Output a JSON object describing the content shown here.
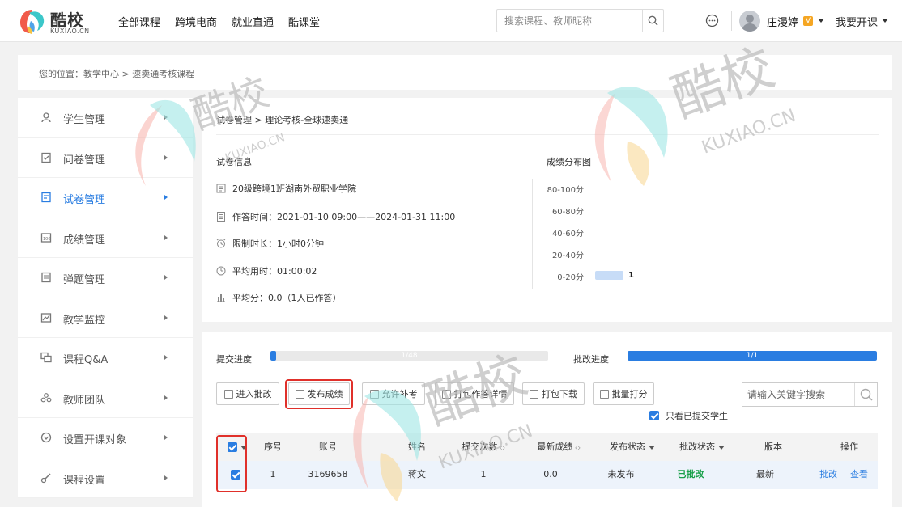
{
  "header": {
    "logo_cn": "酷校",
    "logo_en": "KUXIAO.CN",
    "nav": [
      "全部课程",
      "跨境电商",
      "就业直通",
      "酷课堂"
    ],
    "search_placeholder": "搜索课程、教师昵称",
    "username": "庄漫婷",
    "vip_badge": "V",
    "teach_label": "我要开课"
  },
  "breadcrumb": "您的位置：教学中心 > 速卖通考核课程",
  "sidebar": {
    "items": [
      {
        "label": "学生管理",
        "icon": "students-icon"
      },
      {
        "label": "问卷管理",
        "icon": "survey-icon"
      },
      {
        "label": "试卷管理",
        "icon": "exam-icon",
        "active": true
      },
      {
        "label": "成绩管理",
        "icon": "grades-icon"
      },
      {
        "label": "弹题管理",
        "icon": "popup-quiz-icon"
      },
      {
        "label": "教学监控",
        "icon": "monitor-icon"
      },
      {
        "label": "课程Q&A",
        "icon": "qa-icon"
      },
      {
        "label": "教师团队",
        "icon": "team-icon"
      },
      {
        "label": "设置开课对象",
        "icon": "target-icon"
      },
      {
        "label": "课程设置",
        "icon": "settings-icon"
      }
    ]
  },
  "exam": {
    "path": "试卷管理 > 理论考核-全球速卖通",
    "info_title": "试卷信息",
    "class_name": "20级跨境1班湖南外贸职业学院",
    "time_label": "作答时间：",
    "time_value": "2021-01-10 09:00——2024-01-31 11:00",
    "limit_label": "限制时长：",
    "limit_value": "1小时0分钟",
    "avg_time_label": "平均用时：",
    "avg_time_value": "01:00:02",
    "avg_score_label": "平均分：",
    "avg_score_value": "0.0（1人已作答）"
  },
  "chart_data": {
    "type": "bar",
    "title": "成绩分布图",
    "orientation": "horizontal",
    "categories": [
      "80-100分",
      "60-80分",
      "40-60分",
      "20-40分",
      "0-20分"
    ],
    "values": [
      0,
      0,
      0,
      0,
      1
    ]
  },
  "progress": {
    "submit_label": "提交进度",
    "submit_text": "1/48",
    "submit_fraction": 0.0208,
    "grade_label": "批改进度",
    "grade_text": "1/1",
    "grade_fraction": 1.0
  },
  "toolbar": {
    "buttons": [
      "进入批改",
      "发布成绩",
      "允许补考",
      "打包作答详情",
      "打包下载",
      "批量打分"
    ],
    "search_placeholder": "请输入关键字搜索",
    "only_submitted": "只看已提交学生"
  },
  "table": {
    "columns": [
      "序号",
      "账号",
      "姓名",
      "提交次数",
      "最新成绩",
      "发布状态",
      "批改状态",
      "版本",
      "操作"
    ],
    "rows": [
      {
        "index": "1",
        "account": "3169658",
        "name": "蒋文",
        "submits": "1",
        "score": "0.0",
        "publish": "未发布",
        "grade": "已批改",
        "version": "最新",
        "action_grade": "批改",
        "action_view": "查看"
      }
    ]
  },
  "watermark": {
    "cn": "酷校",
    "en": "KUXIAO.CN"
  },
  "colors": {
    "accent": "#2a7de1",
    "highlight": "#e0302a",
    "success": "#19a04a"
  }
}
